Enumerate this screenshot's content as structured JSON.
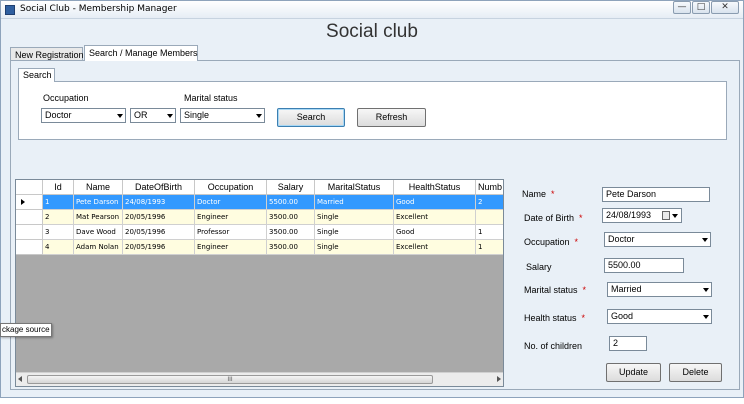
{
  "window": {
    "title": "Social Club - Membership Manager",
    "controls": {
      "minimize": "—",
      "maximize": "□",
      "close": "✕"
    }
  },
  "heading": "Social club",
  "tabs": [
    "New Registration",
    "Search / Manage Members"
  ],
  "search": {
    "tab_label": "Search",
    "occupation_label": "Occupation",
    "occupation_value": "Doctor",
    "operator_value": "OR",
    "marital_label": "Marital status",
    "marital_value": "Single",
    "search_button": "Search",
    "refresh_button": "Refresh"
  },
  "grid": {
    "columns": [
      "Id",
      "Name",
      "DateOfBirth",
      "Occupation",
      "Salary",
      "MaritalStatus",
      "HealthStatus",
      "Numb"
    ],
    "rows": [
      [
        "1",
        "Pete Darson",
        "24/08/1993",
        "Doctor",
        "5500.00",
        "Married",
        "Good",
        "2"
      ],
      [
        "2",
        "Mat Pearson",
        "20/05/1996",
        "Engineer",
        "3500.00",
        "Single",
        "Excellent",
        ""
      ],
      [
        "3",
        "Dave Wood",
        "20/05/1996",
        "Professor",
        "3500.00",
        "Single",
        "Good",
        "1"
      ],
      [
        "4",
        "Adam Nolan",
        "20/05/1996",
        "Engineer",
        "3500.00",
        "Single",
        "Excellent",
        "1"
      ]
    ],
    "selected_row": 0,
    "scroll_grip": "III"
  },
  "tooltip": "ckage source",
  "details": {
    "name_label": "Name",
    "name_value": "Pete Darson",
    "dob_label": "Date of Birth",
    "dob_value": "24/08/1993",
    "occupation_label": "Occupation",
    "occupation_value": "Doctor",
    "salary_label": "Salary",
    "salary_value": "5500.00",
    "marital_label": "Marital status",
    "marital_value": "Married",
    "health_label": "Health status",
    "health_value": "Good",
    "children_label": "No. of children",
    "children_value": "2",
    "required_mark": "*",
    "update_button": "Update",
    "delete_button": "Delete"
  },
  "colors": {
    "selected_row": "#3399ff",
    "odd_row": "#ffffff",
    "even_row": "#fffde0",
    "grid_empty": "#a9a9a9",
    "panel_bg": "#e9f0f7"
  }
}
